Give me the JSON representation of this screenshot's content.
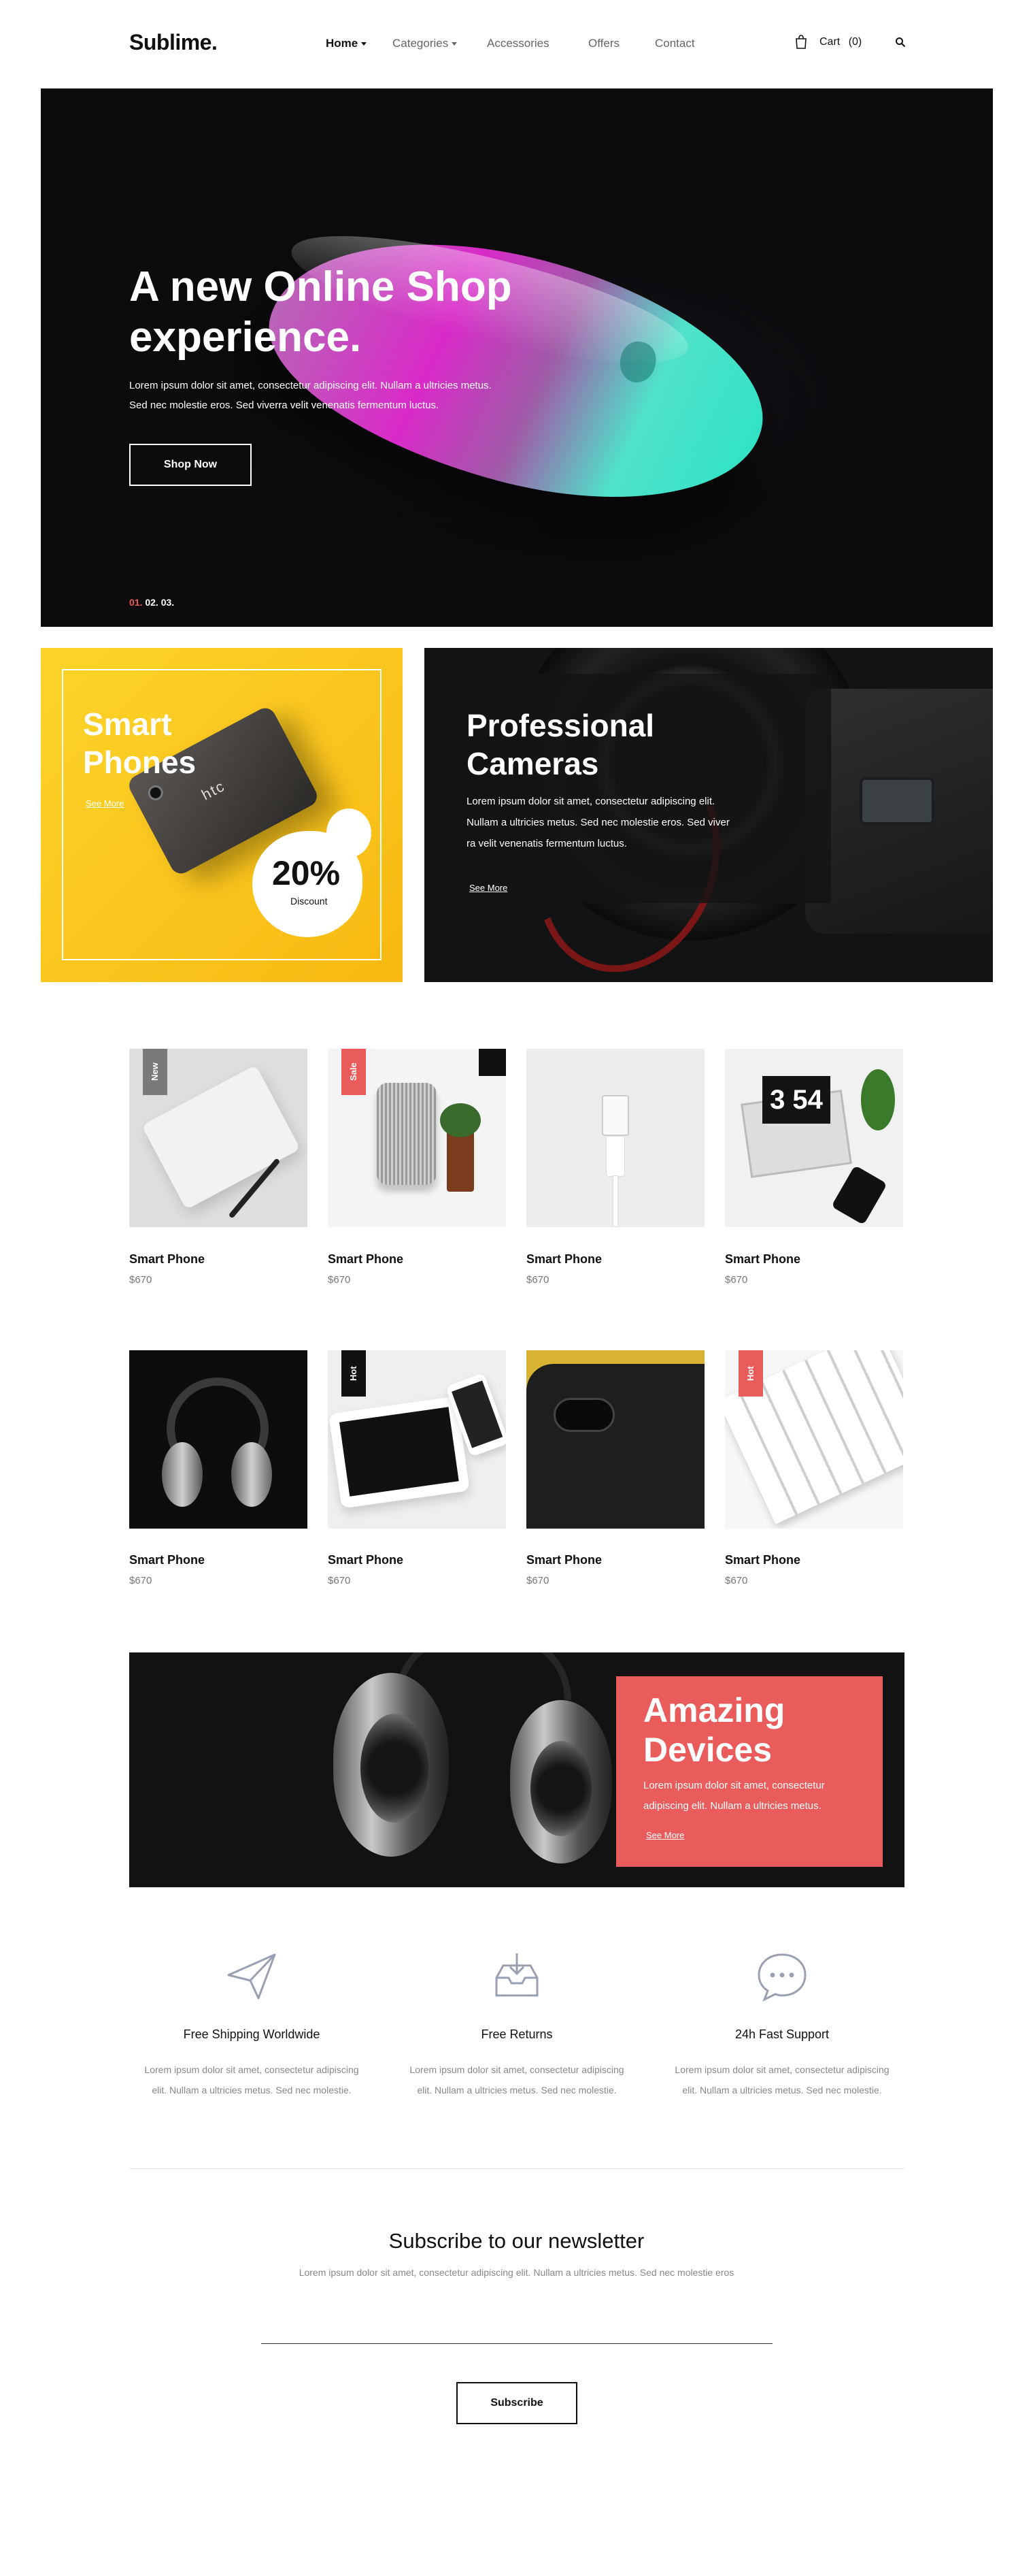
{
  "header": {
    "logo": "Sublime.",
    "nav": [
      "Home",
      "Categories",
      "Accessories",
      "Offers",
      "Contact"
    ],
    "cart_label": "Cart",
    "cart_count": "(0)"
  },
  "hero": {
    "title_line1": "A new Online Shop",
    "title_line2": "experience.",
    "text_line1": "Lorem ipsum dolor sit amet, consectetur adipiscing elit. Nullam a ultricies metus.",
    "text_line2": "Sed nec molestie eros. Sed viverra velit venenatis fermentum luctus.",
    "button": "Shop Now",
    "slides": [
      "01.",
      "02.",
      "03."
    ],
    "active_slide": "01."
  },
  "banner_phones": {
    "title_line1": "Smart",
    "title_line2": "Phones",
    "link": "See More",
    "discount_value": "20%",
    "discount_label": "Discount",
    "phone_brand": "htc"
  },
  "banner_cameras": {
    "title_line1": "Professional",
    "title_line2": "Cameras",
    "text_line1": "Lorem ipsum dolor sit amet, consectetur adipiscing elit.",
    "text_line2": "Nullam a ultricies metus. Sed nec molestie eros. Sed viver",
    "text_line3": "ra velit venenatis fermentum luctus.",
    "link": "See More"
  },
  "products": [
    {
      "name": "Smart Phone",
      "price": "$670",
      "tag": "New",
      "tag_color": "#7a7a7a"
    },
    {
      "name": "Smart Phone",
      "price": "$670",
      "tag": "Sale",
      "tag_color": "#ea5b5b"
    },
    {
      "name": "Smart Phone",
      "price": "$670",
      "tag": "",
      "tag_color": ""
    },
    {
      "name": "Smart Phone",
      "price": "$670",
      "tag": "",
      "tag_color": ""
    },
    {
      "name": "Smart Phone",
      "price": "$670",
      "tag": "",
      "tag_color": ""
    },
    {
      "name": "Smart Phone",
      "price": "$670",
      "tag": "Hot",
      "tag_color": "#111111"
    },
    {
      "name": "Smart Phone",
      "price": "$670",
      "tag": "",
      "tag_color": ""
    },
    {
      "name": "Smart Phone",
      "price": "$670",
      "tag": "Hot",
      "tag_color": "#ea5b5b"
    }
  ],
  "promo": {
    "title_line1": "Amazing",
    "title_line2": "Devices",
    "text_line1": "Lorem ipsum dolor sit amet, consectetur",
    "text_line2": "adipiscing elit. Nullam a ultricies metus.",
    "link": "See More"
  },
  "features": [
    {
      "icon": "paper-plane-icon",
      "title": "Free Shipping Worldwide",
      "text_line1": "Lorem ipsum dolor sit amet, consectetur adipiscing",
      "text_line2": "elit. Nullam a ultricies metus. Sed nec molestie."
    },
    {
      "icon": "inbox-return-icon",
      "title": "Free Returns",
      "text_line1": "Lorem ipsum dolor sit amet, consectetur adipiscing",
      "text_line2": "elit. Nullam a ultricies metus. Sed nec molestie."
    },
    {
      "icon": "chat-bubble-icon",
      "title": "24h Fast Support",
      "text_line1": "Lorem ipsum dolor sit amet, consectetur adipiscing",
      "text_line2": "elit. Nullam a ultricies metus. Sed nec molestie."
    }
  ],
  "newsletter": {
    "title": "Subscribe to our newsletter",
    "text": "Lorem ipsum dolor sit amet, consectetur adipiscing elit. Nullam a ultricies metus. Sed nec molestie eros",
    "email_value": "",
    "button": "Subscribe"
  },
  "colors": {
    "accent": "#ea5b5b",
    "yellow": "#fdc51c",
    "dark": "#0c0b0d"
  }
}
